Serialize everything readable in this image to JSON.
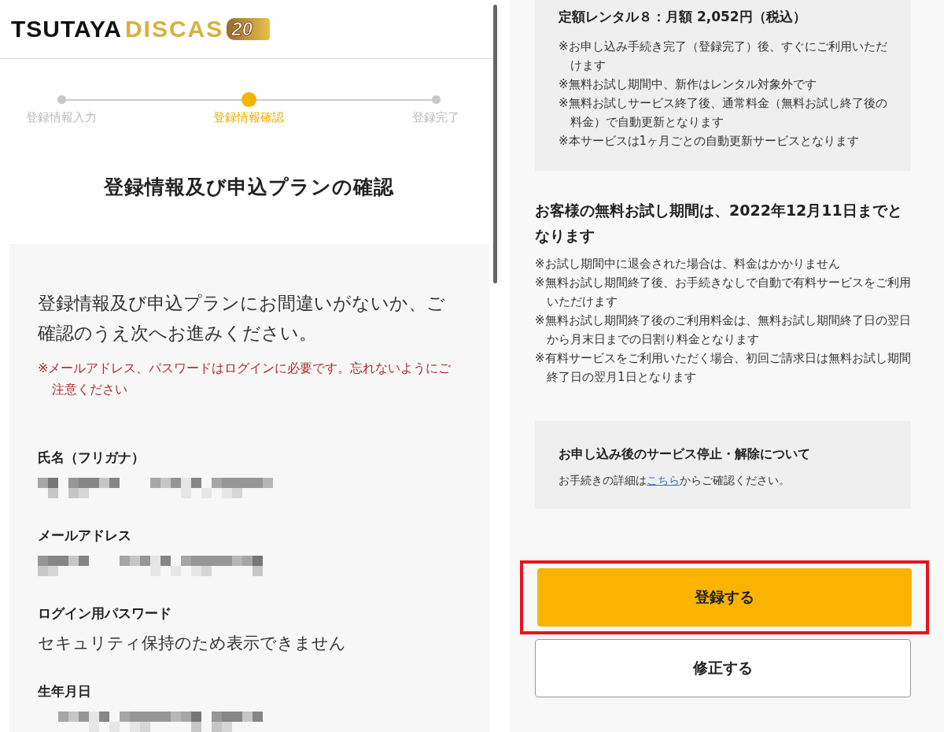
{
  "left": {
    "logo": {
      "brand": "TSUTAYA",
      "product": "DISCAS",
      "badge": "20"
    },
    "steps": [
      {
        "label": "登録情報入力",
        "selected": false
      },
      {
        "label": "登録情報確認",
        "selected": true
      },
      {
        "label": "登録完了",
        "selected": false
      }
    ],
    "title": "登録情報及び申込プランの確認",
    "intro": "登録情報及び申込プランにお間違いがないか、ご確認のうえ次へお進みください。",
    "warning": "※メールアドレス、パスワードはログインに必要です。忘れないようにご注意ください",
    "fields": [
      {
        "label": "氏名（フリガナ）",
        "masked": true
      },
      {
        "label": "メールアドレス",
        "masked": true
      },
      {
        "label": "ログイン用パスワード",
        "masked": false,
        "value": "セキュリティ保持のため表示できません"
      },
      {
        "label": "生年月日",
        "masked": true
      }
    ]
  },
  "right": {
    "plan": "定額レンタル８：月額 2,052円（税込）",
    "plan_notes": [
      "※お申し込み手続き完了（登録完了）後、すぐにご利用いただけます",
      "※無料お試し期間中、新作はレンタル対象外です",
      "※無料お試しサービス終了後、通常料金（無料お試し終了後の料金）で自動更新となります",
      "※本サービスは1ヶ月ごとの自動更新サービスとなります"
    ],
    "trial_heading": "お客様の無料お試し期間は、2022年12月11日までとなります",
    "trial_notes": [
      "※お試し期間中に退会された場合は、料金はかかりません",
      "※無料お試し期間終了後、お手続きなしで自動で有料サービスをご利用いただけます",
      "※無料お試し期間終了後のご利用料金は、無料お試し期間終了日の翌日から月末日までの日割り料金となります",
      "※有料サービスをご利用いただく場合、初回ご請求日は無料お試し期間終了日の翌月1日となります"
    ],
    "cancel_box": {
      "title": "お申し込み後のサービス停止・解除について",
      "text_before": "お手続きの詳細は",
      "link": "こちら",
      "text_after": "からご確認ください。"
    },
    "buttons": [
      {
        "label": "登録する",
        "kind": "primary",
        "highlighted": true
      },
      {
        "label": "修正する",
        "kind": "secondary",
        "highlighted": false
      }
    ]
  }
}
